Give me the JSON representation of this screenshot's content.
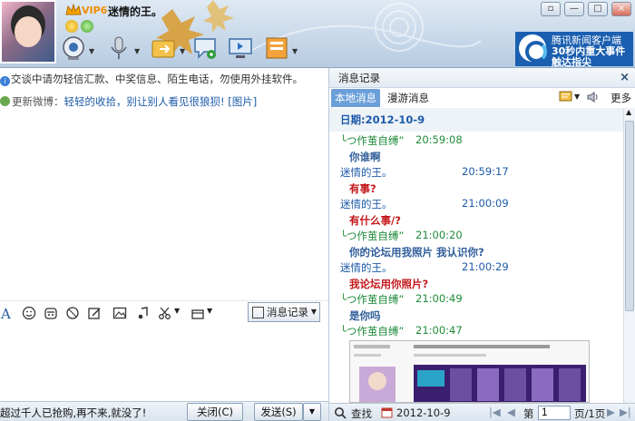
{
  "header": {
    "vip_label": "VIP6",
    "contact_name": "迷情的王。",
    "window_controls": [
      "minimize",
      "maximize",
      "close"
    ],
    "toolbar_icons": [
      "video-call-icon",
      "voice-call-icon",
      "send-file-icon",
      "sms-icon",
      "remote-assist-icon",
      "app-box-icon"
    ]
  },
  "ad": {
    "line1": "腾讯新闻客户端",
    "line2": "30秒内重大事件",
    "line3": "触达指尖"
  },
  "chat": {
    "notice": "交谈中请勿轻信汇款、中奖信息、陌生电话，勿使用外挂软件。",
    "weibo_label": "更新微博：",
    "weibo_text": "轻轻的收拾，别让别人看见很狼狈!",
    "weibo_pic": "[图片]",
    "message_record_button": "消息记录",
    "ad_text": "超过千人已抢购,再不来,就没了!",
    "close_button": "关闭(C)",
    "send_button": "发送(S)"
  },
  "history": {
    "title": "消息记录",
    "close_glyph": "×",
    "tab_local": "本地消息",
    "tab_roam": "漫游消息",
    "more": "更多",
    "date_label": "日期:",
    "date_value": "2012-10-9",
    "messages": [
      {
        "sender": "╰つ作茧自缚”",
        "time": "20:59:08",
        "text": "你谁啊",
        "text_color": "blue",
        "is_self": false
      },
      {
        "sender": "迷情的王。",
        "time": "20:59:17",
        "text": "有事?",
        "text_color": "red",
        "is_self": true
      },
      {
        "sender": "迷情的王。",
        "time": "21:00:09",
        "text": "有什么事/?",
        "text_color": "red",
        "is_self": true
      },
      {
        "sender": "╰つ作茧自缚”",
        "time": "21:00:20",
        "text": "你的论坛用我照片  我认识你?",
        "text_color": "blue",
        "is_self": false
      },
      {
        "sender": "迷情的王。",
        "time": "21:00:29",
        "text": "我论坛用你照片?",
        "text_color": "red",
        "is_self": true
      },
      {
        "sender": "╰つ作茧自缚”",
        "time": "21:00:49",
        "text": "是你吗",
        "text_color": "blue",
        "is_self": false
      },
      {
        "sender": "╰つ作茧自缚”",
        "time": "21:00:47",
        "text": "",
        "text_color": "blue",
        "is_self": false
      }
    ],
    "search_label": "查找",
    "footer_date": "2012-10-9",
    "page_prefix": "第",
    "page_value": "1",
    "page_suffix": "页/1页"
  },
  "colors": {
    "accent": "#1d5aa8",
    "other_sender": "#1f8b3a",
    "self_sender": "#1d5aa8",
    "red_text": "#c4181b",
    "blue_text": "#2f5d9a",
    "ad_bg": "#1a5fb0"
  }
}
